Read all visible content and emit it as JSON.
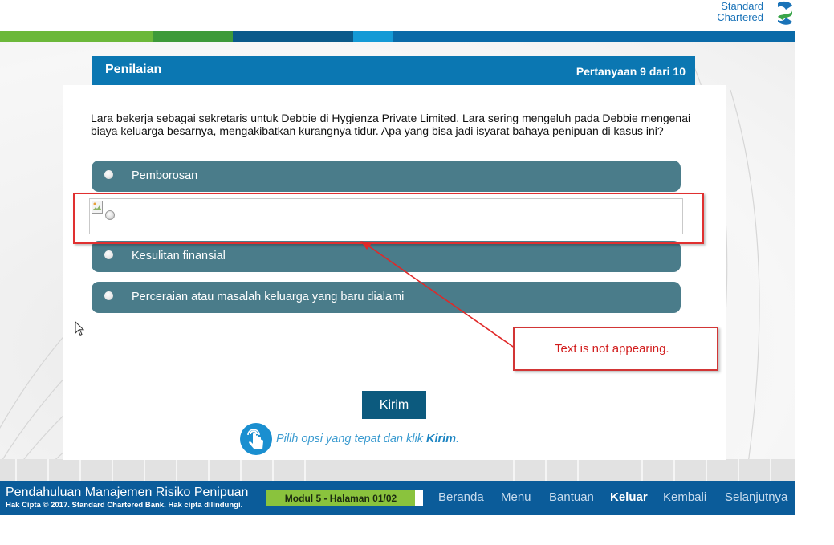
{
  "brand": {
    "name_line1": "Standard",
    "name_line2": "Chartered"
  },
  "colors": {
    "header_blue": "#0b77b2",
    "option_teal": "#4a7c8a",
    "footer_blue": "#0b5c9a",
    "module_green": "#8ac33d",
    "annotation_red": "#d21d1d",
    "stripe_colors": [
      "#6cb83a",
      "#3e9a3a",
      "#0b5a8a",
      "#149ad6",
      "#0a6aa8"
    ]
  },
  "panel": {
    "title": "Penilaian",
    "counter": "Pertanyaan  9  dari 10"
  },
  "question": "Lara bekerja sebagai sekretaris untuk Debbie di Hygienza Private Limited. Lara sering mengeluh pada Debbie mengenai biaya keluarga besarnya, mengakibatkan kurangnya tidur. Apa yang bisa jadi isyarat bahaya penipuan di kasus ini?",
  "options": [
    {
      "label": "Pemborosan"
    },
    {
      "label": ""
    },
    {
      "label": "Kesulitan finansial"
    },
    {
      "label": "Perceraian atau masalah keluarga yang baru dialami"
    }
  ],
  "annotation": {
    "callout_text": "Text is not appearing."
  },
  "submit": {
    "label": "Kirim"
  },
  "hint": {
    "text": "Pilih opsi yang tepat dan klik ",
    "keyword": "Kirim",
    "end": "."
  },
  "footer": {
    "course_title": "Pendahuluan Manajemen Risiko Penipuan",
    "copyright": "Hak Cipta © 2017. Standard Chartered Bank. Hak cipta dilindungi.",
    "module": "Modul 5 - Halaman 01/02",
    "nav": [
      {
        "label": "Beranda"
      },
      {
        "label": "Menu"
      },
      {
        "label": "Bantuan"
      },
      {
        "label": "Keluar"
      },
      {
        "label": "Kembali"
      },
      {
        "label": "Selanjutnya"
      }
    ]
  }
}
